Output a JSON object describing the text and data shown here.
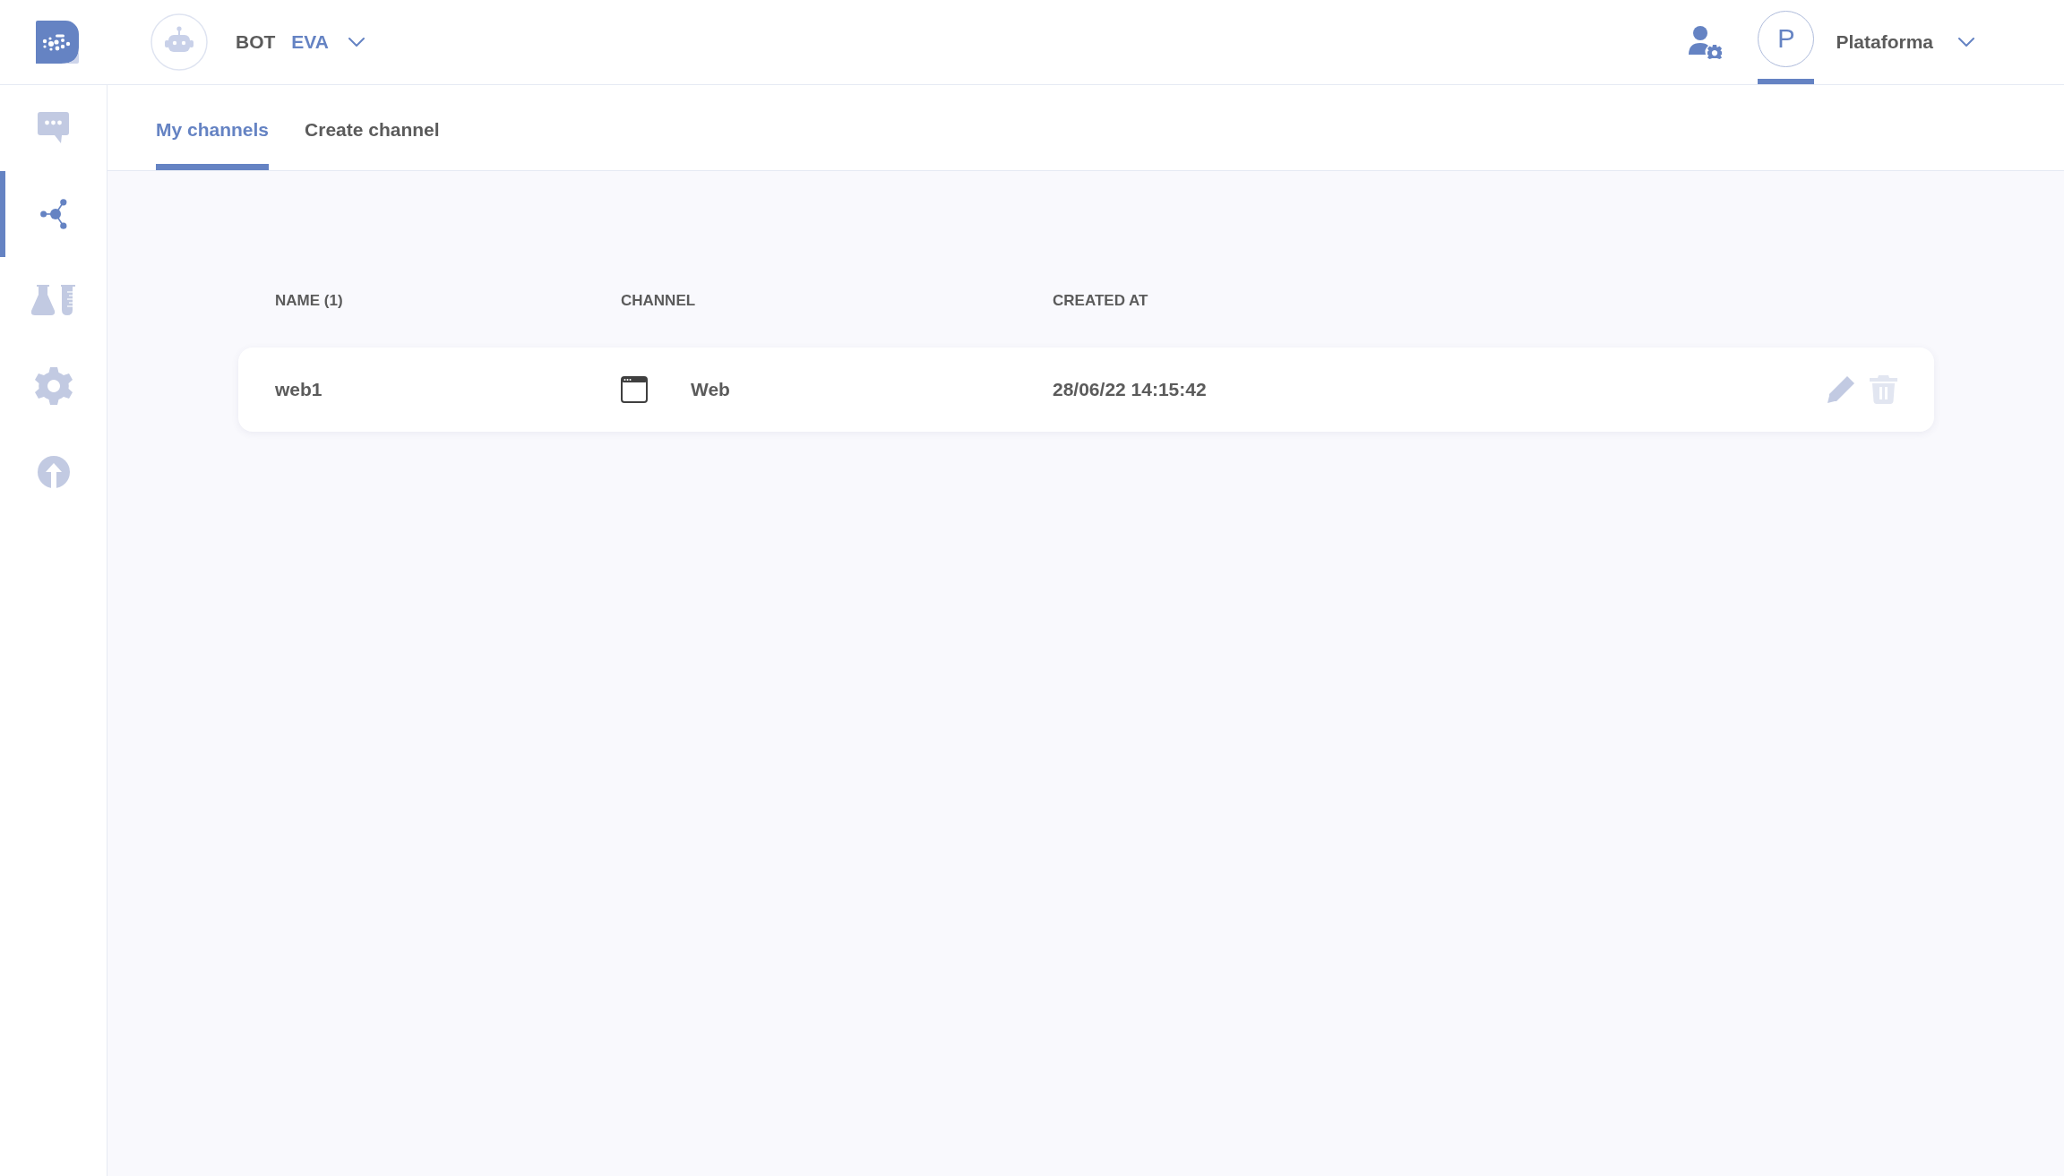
{
  "header": {
    "bot": {
      "label": "BOT",
      "name": "EVA"
    },
    "workspace": {
      "initial": "P",
      "name": "Plataforma",
      "selected": true
    }
  },
  "sidebar": {
    "items": [
      {
        "selected": false
      },
      {
        "selected": true
      },
      {
        "selected": false
      },
      {
        "selected": false
      },
      {
        "selected": false
      }
    ]
  },
  "tabs": [
    {
      "label": "My channels",
      "selected": true
    },
    {
      "label": "Create channel",
      "selected": false
    }
  ],
  "table": {
    "columns": [
      "NAME (1)",
      "CHANNEL",
      "CREATED AT"
    ],
    "rows": [
      {
        "name": "web1",
        "channel": "Web",
        "created_at": "28/06/22 14:15:42"
      }
    ]
  }
}
